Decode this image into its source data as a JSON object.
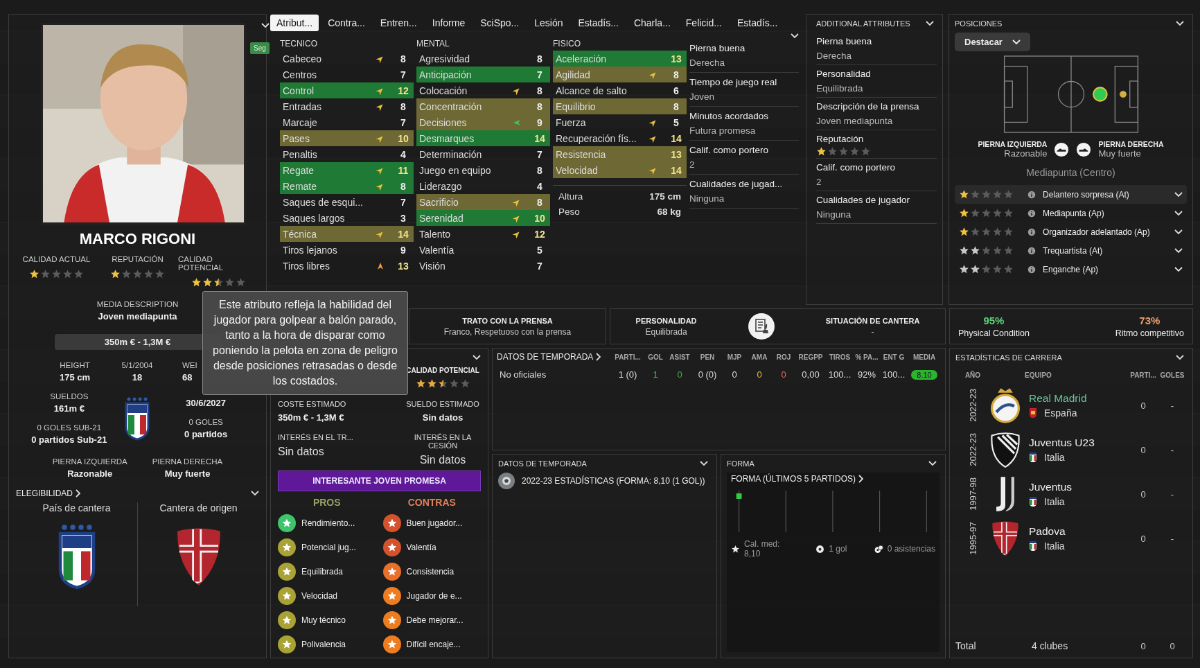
{
  "player": {
    "name": "MARCO RIGONI",
    "badge": "Seg",
    "ratings": [
      {
        "label": "CALIDAD ACTUAL",
        "stars": 1
      },
      {
        "label": "REPUTACIÓN",
        "stars": 1
      },
      {
        "label": "CALIDAD POTENCIAL",
        "stars": 2.5
      }
    ],
    "media_description": {
      "label": "MEDIA DESCRIPTION",
      "value": "Joven mediapunta"
    },
    "value_range": "350m € - 1,3M €",
    "facts": [
      {
        "label": "HEIGHT",
        "value": "175 cm"
      },
      {
        "label": "5/1/2004",
        "value": "18"
      },
      {
        "label": "WEI",
        "value": "68"
      }
    ],
    "wages": {
      "label": "SUELDOS",
      "value": "161m €"
    },
    "contract_end": "30/6/2027",
    "intl": [
      {
        "label": "0 GOLES SUB-21",
        "value": "0 partidos Sub-21"
      },
      {
        "label": "0 GOLES",
        "value": "0 partidos"
      }
    ],
    "feet": [
      {
        "label": "PIERNA IZQUIERDA",
        "value": "Razonable"
      },
      {
        "label": "PIERNA DERECHA",
        "value": "Muy fuerte"
      }
    ],
    "eligibility": {
      "title": "ELEGIBILIDAD",
      "items": [
        "País de cantera",
        "Cantera de origen"
      ]
    }
  },
  "tabs": [
    {
      "label": "Atribut...",
      "selected": true
    },
    {
      "label": "Contra...",
      "selected": false
    },
    {
      "label": "Entren...",
      "selected": false
    },
    {
      "label": "Informe",
      "selected": false
    },
    {
      "label": "SciSpo...",
      "selected": false
    },
    {
      "label": "Lesión",
      "selected": false
    },
    {
      "label": "Estadís...",
      "selected": false
    },
    {
      "label": "Charla...",
      "selected": false
    },
    {
      "label": "Felicid...",
      "selected": false
    },
    {
      "label": "Estadís...",
      "selected": false
    }
  ],
  "attributes": {
    "groups": [
      {
        "title": "TECNICO",
        "items": [
          {
            "name": "Cabeceo",
            "value": "8",
            "kind": "rising"
          },
          {
            "name": "Centros",
            "value": "7",
            "kind": "plain"
          },
          {
            "name": "Control",
            "value": "12",
            "kind": "rising",
            "color": "#1f7a35"
          },
          {
            "name": "Entradas",
            "value": "8",
            "kind": "rising"
          },
          {
            "name": "Marcaje",
            "value": "7",
            "kind": "plain"
          },
          {
            "name": "Pases",
            "value": "10",
            "kind": "rising",
            "color": "#6d6834"
          },
          {
            "name": "Penaltis",
            "value": "4",
            "kind": "plain"
          },
          {
            "name": "Regate",
            "value": "11",
            "kind": "rising",
            "color": "#1f7a35"
          },
          {
            "name": "Remate",
            "value": "8",
            "kind": "rising",
            "color": "#1f7a35"
          },
          {
            "name": "Saques de esqui...",
            "value": "7",
            "kind": "plain"
          },
          {
            "name": "Saques largos",
            "value": "3",
            "kind": "plain"
          },
          {
            "name": "Técnica",
            "value": "14",
            "kind": "rising",
            "color": "#6d6834"
          },
          {
            "name": "Tiros lejanos",
            "value": "9",
            "kind": "plain"
          },
          {
            "name": "Tiros libres",
            "value": "13",
            "kind": "surging"
          }
        ]
      },
      {
        "title": "MENTAL",
        "items": [
          {
            "name": "Agresividad",
            "value": "8",
            "kind": "plain"
          },
          {
            "name": "Anticipación",
            "value": "7",
            "kind": "plain",
            "color": "#1f7a35"
          },
          {
            "name": "Colocación",
            "value": "8",
            "kind": "rising"
          },
          {
            "name": "Concentración",
            "value": "8",
            "kind": "plain",
            "color": "#6d6834"
          },
          {
            "name": "Decisiones",
            "value": "9",
            "kind": "slipping",
            "color": "#6d6834"
          },
          {
            "name": "Desmarques",
            "value": "14",
            "kind": "plain",
            "color": "#1f7a35"
          },
          {
            "name": "Determinación",
            "value": "7",
            "kind": "plain"
          },
          {
            "name": "Juego en equipo",
            "value": "8",
            "kind": "plain"
          },
          {
            "name": "Liderazgo",
            "value": "4",
            "kind": "plain"
          },
          {
            "name": "Sacrificio",
            "value": "8",
            "kind": "rising",
            "color": "#6d6834"
          },
          {
            "name": "Serenidad",
            "value": "10",
            "kind": "rising",
            "color": "#1f7a35"
          },
          {
            "name": "Talento",
            "value": "12",
            "kind": "rising"
          },
          {
            "name": "Valentía",
            "value": "5",
            "kind": "plain"
          },
          {
            "name": "Visión",
            "value": "7",
            "kind": "plain"
          }
        ]
      },
      {
        "title": "FISICO",
        "items": [
          {
            "name": "Aceleración",
            "value": "13",
            "kind": "plain",
            "color": "#1f7a35"
          },
          {
            "name": "Agilidad",
            "value": "8",
            "kind": "rising",
            "color": "#6d6834"
          },
          {
            "name": "Alcance de salto",
            "value": "6",
            "kind": "plain"
          },
          {
            "name": "Equilibrio",
            "value": "8",
            "kind": "plain",
            "color": "#6d6834"
          },
          {
            "name": "Fuerza",
            "value": "5",
            "kind": "rising"
          },
          {
            "name": "Recuperación fís...",
            "value": "14",
            "kind": "rising"
          },
          {
            "name": "Resistencia",
            "value": "13",
            "kind": "plain",
            "color": "#6d6834"
          },
          {
            "name": "Velocidad",
            "value": "14",
            "kind": "rising",
            "color": "#6d6834"
          }
        ]
      }
    ],
    "physique": [
      {
        "label": "Altura",
        "value": "175 cm"
      },
      {
        "label": "Peso",
        "value": "68 kg"
      }
    ],
    "info": [
      {
        "label": "Pierna buena",
        "value": "Derecha"
      },
      {
        "label": "Tiempo de juego real",
        "value": "Joven"
      },
      {
        "label": "Minutos acordados",
        "value": "Futura promesa"
      },
      {
        "label": "Calif. como portero",
        "value": "2"
      },
      {
        "label": "Cualidades de jugad...",
        "value": "Ninguna"
      }
    ]
  },
  "additional": {
    "title": "ADDITIONAL ATTRIBUTES",
    "items": [
      {
        "kind": "text",
        "label": "Pierna buena",
        "value": "Derecha"
      },
      {
        "kind": "text",
        "label": "Personalidad",
        "value": "Equilibrada"
      },
      {
        "kind": "text",
        "label": "Descripción de la prensa",
        "value": "Joven mediapunta"
      },
      {
        "kind": "stars",
        "label": "Reputación",
        "stars": 1
      },
      {
        "kind": "text",
        "label": "Calif. como portero",
        "value": "2"
      },
      {
        "kind": "text",
        "label": "Cualidades de jugador",
        "value": "Ninguna"
      }
    ]
  },
  "positions": {
    "title": "POSICIONES",
    "filter": "Destacar",
    "feet": [
      {
        "label": "PIERNA IZQUIERDA",
        "value": "Razonable"
      },
      {
        "label": "PIERNA DERECHA",
        "value": "Muy fuerte"
      }
    ],
    "position": "Mediapunta (Centro)",
    "roles": [
      {
        "name": "Delantero sorpresa (At)",
        "stars": 1,
        "color": "#f2c23c",
        "selected": true
      },
      {
        "name": "Mediapunta (Ap)",
        "stars": 1,
        "color": "#f2c23c",
        "selected": false
      },
      {
        "name": "Organizador adelantado (Ap)",
        "stars": 1,
        "color": "#f2c23c",
        "selected": false
      },
      {
        "name": "Trequartista (At)",
        "stars": 2,
        "color": "#c8c8c8",
        "selected": false
      },
      {
        "name": "Enganche (Ap)",
        "stars": 2,
        "color": "#c8c8c8",
        "selected": false
      }
    ]
  },
  "tooltip": "Este atributo refleja la habilidad del jugador para golpear a balón parado, tanto a la hora de disparar como poniendo la pelota en zona de peligro desde posiciones retrasadas o desde los costados.",
  "strip": {
    "press": {
      "label": "TRATO CON LA PRENSA",
      "value": "Franco, Respetuoso con la prensa"
    },
    "personality": {
      "label": "PERSONALIDAD",
      "value": "Equilibrada"
    },
    "academy": {
      "label": "SITUACIÓN DE CANTERA",
      "value": "-"
    },
    "condition": [
      {
        "value": "95%",
        "label": "Physical Condition",
        "color": "#5cd67a"
      },
      {
        "value": "73%",
        "label": "Ritmo competitivo",
        "color": "#f0a070"
      }
    ]
  },
  "scout": {
    "potential": {
      "label": "CALIDAD POTENCIAL",
      "stars": 2.5
    },
    "fields": [
      {
        "label": "COSTE ESTIMADO",
        "value": "350m € - 1,3M €"
      },
      {
        "label": "SUELDO ESTIMADO",
        "value": "Sin datos"
      },
      {
        "label": "INTERÉS EN EL TR...",
        "value": "Sin datos"
      },
      {
        "label": "INTERÉS EN LA CESIÓN",
        "value": "Sin datos"
      }
    ],
    "verdict": "INTERESANTE JOVEN PROMESA",
    "pros_title": "PROS",
    "cons_title": "CONTRAS",
    "pros": [
      {
        "label": "Rendimiento...",
        "color": "#3ec46d"
      },
      {
        "label": "Potencial jug...",
        "color": "#a9a235"
      },
      {
        "label": "Equilibrada",
        "color": "#a9a235"
      },
      {
        "label": "Velocidad",
        "color": "#a9a235"
      },
      {
        "label": "Muy técnico",
        "color": "#a9a235"
      },
      {
        "label": "Polivalencia",
        "color": "#a9a235"
      }
    ],
    "cons": [
      {
        "label": "Buen jugador...",
        "color": "#d4532c"
      },
      {
        "label": "Valentía",
        "color": "#d4532c"
      },
      {
        "label": "Consistencia",
        "color": "#e8702a"
      },
      {
        "label": "Jugador de e...",
        "color": "#ee7d22"
      },
      {
        "label": "Debe mejorar...",
        "color": "#ee7d22"
      },
      {
        "label": "Difícil encaje...",
        "color": "#ee7d22"
      }
    ]
  },
  "season_table": {
    "title": "DATOS DE TEMPORADA",
    "columns": [
      "PARTI...",
      "GOL",
      "ASIST",
      "PEN",
      "MJP",
      "AMA",
      "ROJ",
      "REGPP",
      "TIROS",
      "% PA...",
      "ENT G",
      "MEDIA"
    ],
    "rows": [
      {
        "label": "No oficiales",
        "cells": [
          "1 (0)",
          "1",
          "0",
          "0 (0)",
          "0",
          "0",
          "0",
          "0,00",
          "100...",
          "92%",
          "100...",
          "8.10"
        ]
      }
    ]
  },
  "season_data": {
    "title": "DATOS DE TEMPORADA",
    "line": "2022-23 ESTADÍSTICAS (FORMA: 8,10 (1 GOL))"
  },
  "form": {
    "title": "FORMA",
    "subtitle": "FORMA (ÚLTIMOS 5 PARTIDOS)",
    "rating": "Cal. med: 8,10",
    "goals": "1 gol",
    "assists": "0 asistencias"
  },
  "career": {
    "title": "ESTADÍSTICAS DE CARRERA",
    "columns": [
      "AÑO",
      "EQUIPO",
      "PARTI...",
      "GOLES"
    ],
    "rows": [
      {
        "year": "2022-23",
        "team": "Real Madrid",
        "country": "España",
        "apps": "0",
        "goals": "-",
        "current": true,
        "kind": "round"
      },
      {
        "year": "2022-23",
        "team": "Juventus U23",
        "country": "Italia",
        "apps": "0",
        "goals": "-",
        "current": false,
        "kind": "striped"
      },
      {
        "year": "1997-98",
        "team": "Juventus",
        "country": "Italia",
        "apps": "0",
        "goals": "-",
        "current": false,
        "kind": "plain"
      },
      {
        "year": "1995-97",
        "team": "Padova",
        "country": "Italia",
        "apps": "0",
        "goals": "-",
        "current": false,
        "kind": "cross"
      }
    ],
    "total": {
      "label": "Total",
      "clubs": "4 clubes",
      "apps": "0",
      "goals": "0"
    }
  }
}
